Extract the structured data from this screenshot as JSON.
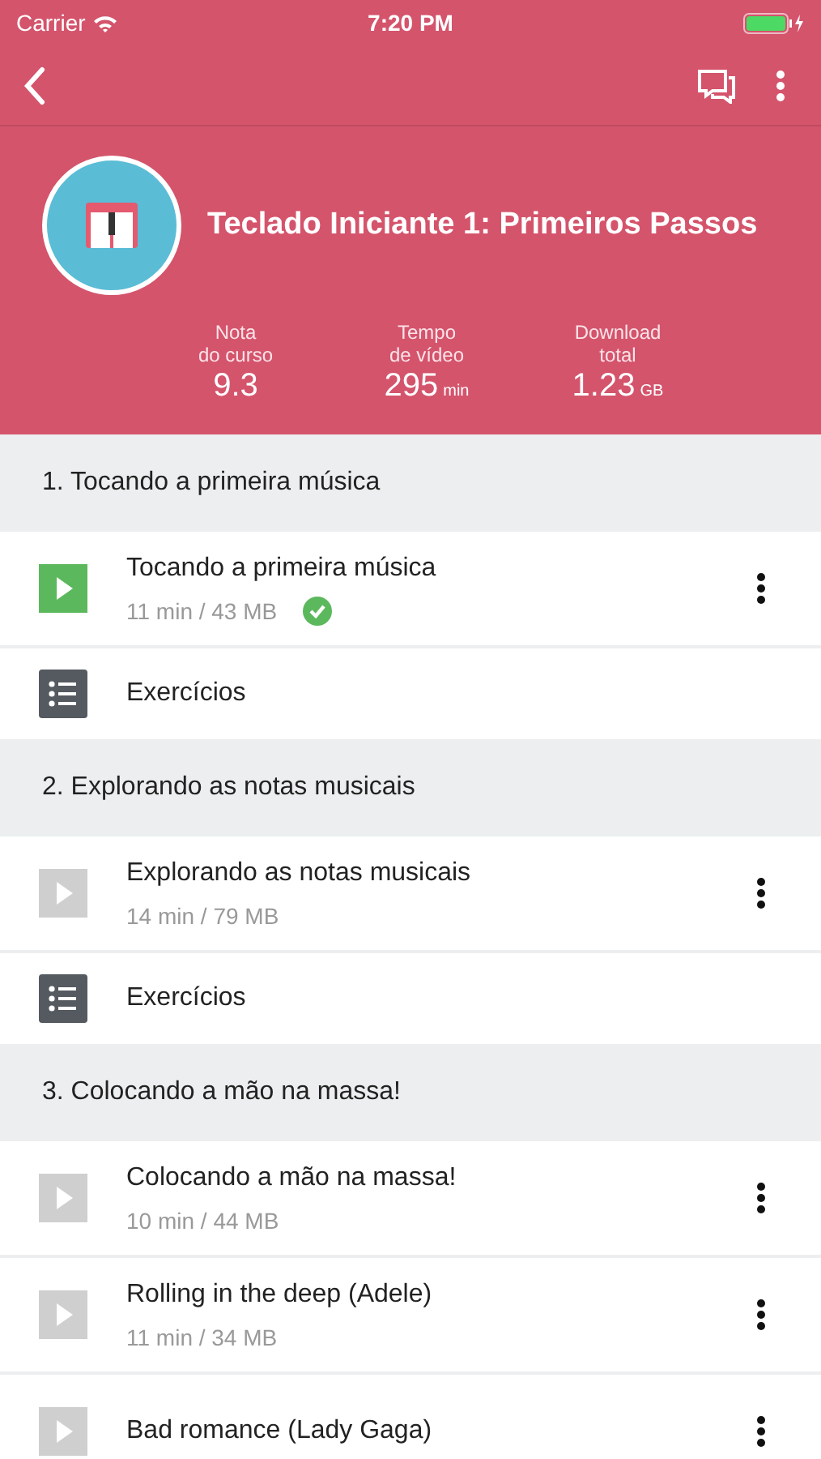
{
  "status_bar": {
    "carrier": "Carrier",
    "time": "7:20 PM"
  },
  "course": {
    "title": "Teclado Iniciante 1: Primeiros Passos"
  },
  "stats": [
    {
      "label_lines": [
        "Nota",
        "do curso"
      ],
      "value": "9.3"
    },
    {
      "label_lines": [
        "Tempo",
        "de vídeo"
      ],
      "value": "295",
      "unit": "min"
    },
    {
      "label_lines": [
        "Download",
        "total"
      ],
      "value": "1.23",
      "unit": "GB"
    }
  ],
  "sections": [
    {
      "title": "1. Tocando a primeira música",
      "items": [
        {
          "kind": "video",
          "title": "Tocando a primeira música",
          "meta": "11 min / 43 MB",
          "completed": true
        },
        {
          "kind": "exercise",
          "title": "Exercícios"
        }
      ]
    },
    {
      "title": "2. Explorando as notas musicais",
      "items": [
        {
          "kind": "video",
          "title": "Explorando as notas musicais",
          "meta": "14 min / 79 MB",
          "completed": false
        },
        {
          "kind": "exercise",
          "title": "Exercícios"
        }
      ]
    },
    {
      "title": "3. Colocando a mão na massa!",
      "items": [
        {
          "kind": "video",
          "title": "Colocando a mão na massa!",
          "meta": "10 min / 44 MB",
          "completed": false
        },
        {
          "kind": "video",
          "title": "Rolling in the deep (Adele)",
          "meta": "11 min / 34 MB",
          "completed": false
        },
        {
          "kind": "video",
          "title": "Bad romance (Lady Gaga)",
          "completed": false
        }
      ]
    }
  ]
}
